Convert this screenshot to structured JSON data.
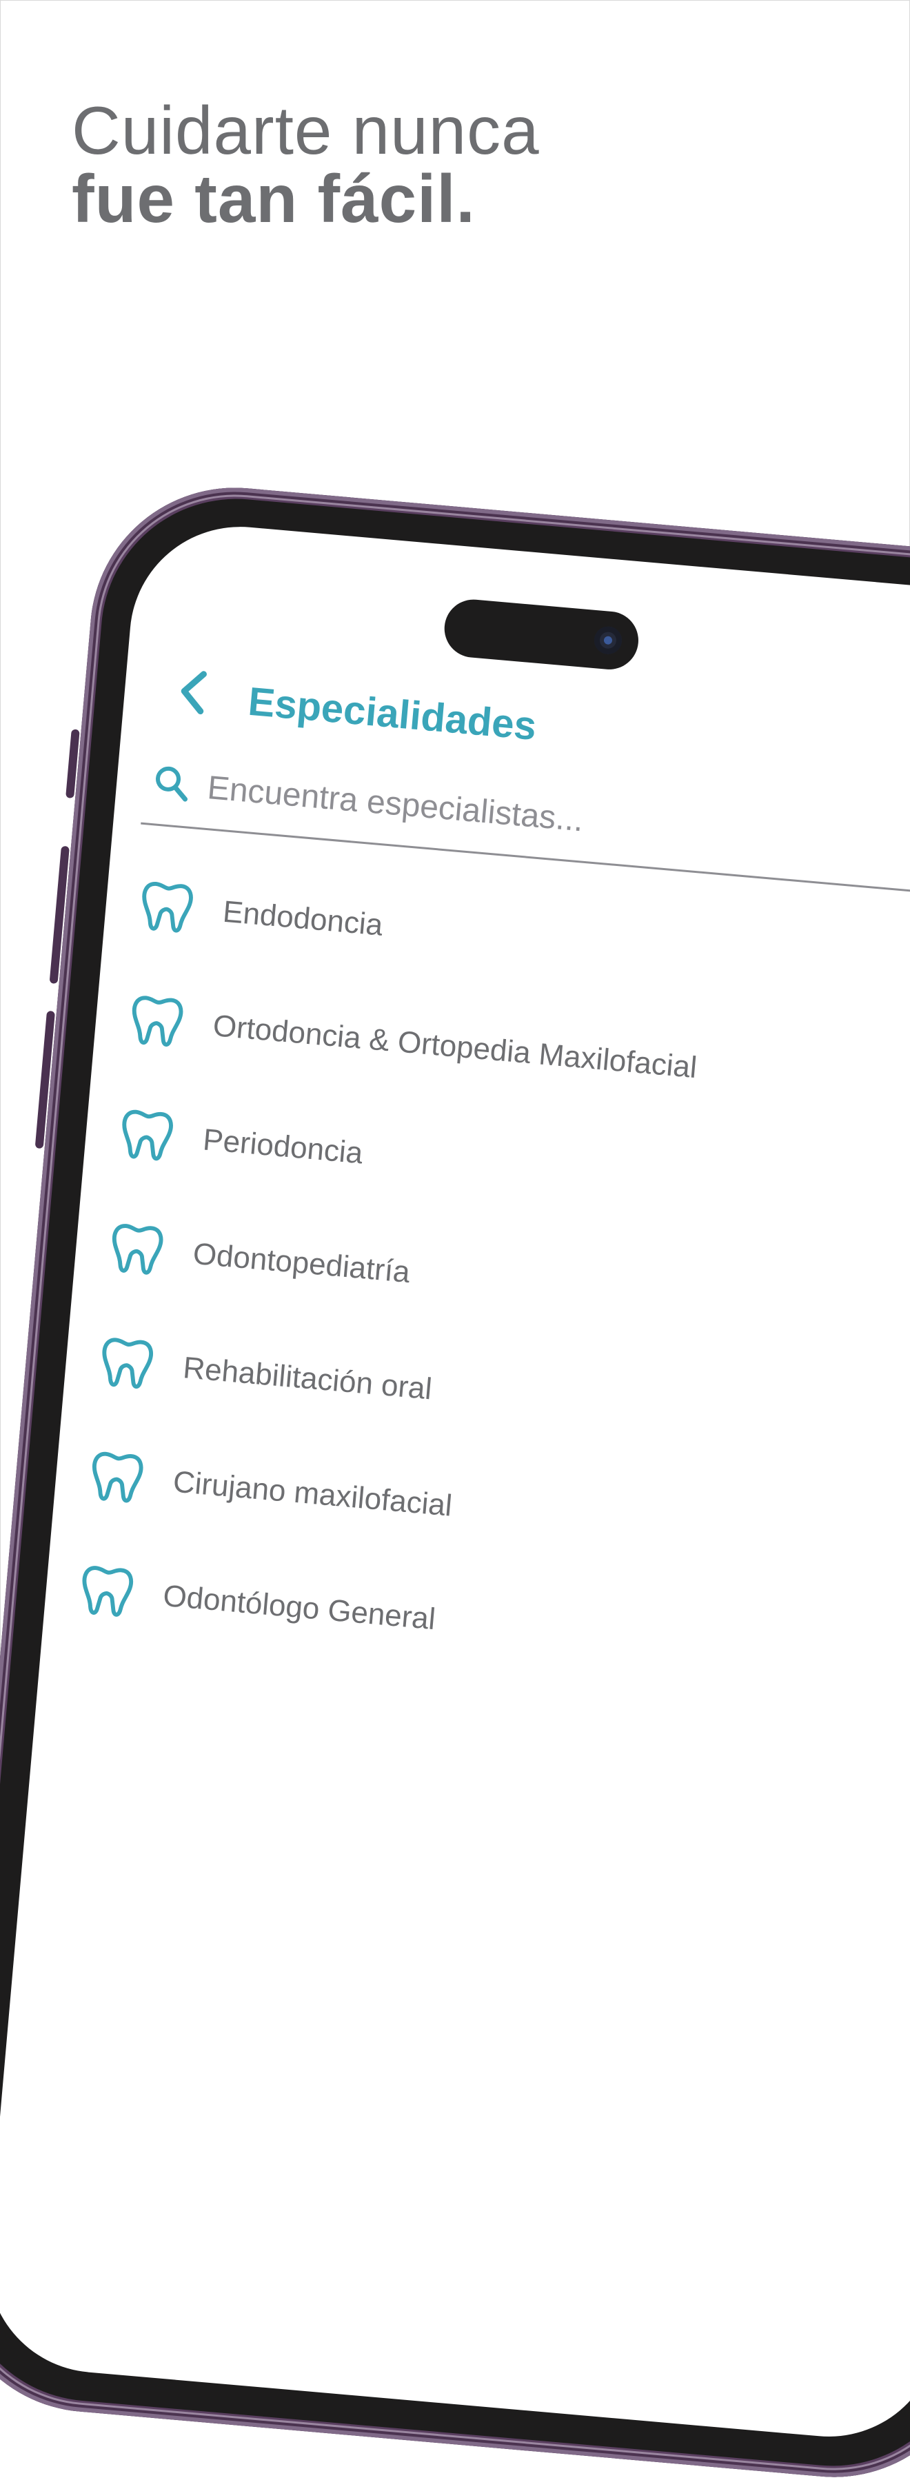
{
  "headline": {
    "line1": "Cuidarte nunca",
    "line2": "fue tan fácil."
  },
  "colors": {
    "accent": "#3aa5b9",
    "text_gray": "#6d6e71",
    "phone_frame": "#5a3f60",
    "bezel": "#1d1c1c"
  },
  "app": {
    "back_icon": "chevron-left-icon",
    "title": "Especialidades",
    "search": {
      "icon": "search-icon",
      "placeholder": "Encuentra especialistas..."
    },
    "specialties": [
      {
        "label": "Endodoncia",
        "icon": "tooth-icon"
      },
      {
        "label": "Ortodoncia & Ortopedia Maxilofacial",
        "icon": "tooth-icon"
      },
      {
        "label": "Periodoncia",
        "icon": "tooth-icon"
      },
      {
        "label": "Odontopediatría",
        "icon": "tooth-icon"
      },
      {
        "label": "Rehabilitación oral",
        "icon": "tooth-icon"
      },
      {
        "label": "Cirujano maxilofacial",
        "icon": "tooth-icon"
      },
      {
        "label": "Odontólogo General",
        "icon": "tooth-icon"
      }
    ]
  }
}
